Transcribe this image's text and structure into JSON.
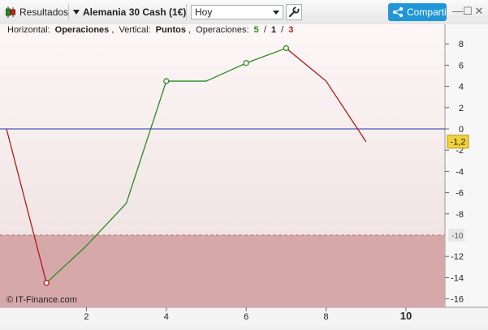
{
  "toolbar": {
    "results_label": "Resultados",
    "instrument": "Alemania 30 Cash (1€)",
    "period_value": "Hoy",
    "share_label": "Compartir"
  },
  "header": {
    "h_label": "Horizontal:",
    "h_value": "Operaciones",
    "sep1": ",",
    "v_label": "Vertical:",
    "v_value": "Puntos",
    "sep2": ",",
    "ops_label": "Operaciones:",
    "ops_win": "5",
    "slash1": "/",
    "ops_even": "1",
    "slash2": "/",
    "ops_loss": "3"
  },
  "watermark": "© IT-Finance.com",
  "colors": {
    "gain": "#2a8a1f",
    "loss": "#b01a1a",
    "zero": "#2233aa",
    "accent": "#2196d6"
  },
  "chart_data": {
    "type": "line",
    "x": [
      0,
      1,
      2,
      3,
      4,
      5,
      6,
      7,
      8,
      9
    ],
    "y": [
      0,
      -14.5,
      -11,
      -7,
      4.5,
      4.5,
      6.2,
      7.6,
      4.5,
      -1.2
    ],
    "marked_points": [
      1,
      4,
      6,
      7
    ],
    "xlim": [
      0,
      11
    ],
    "ylim": [
      -17,
      10
    ],
    "x_ticks": [
      {
        "v": 2,
        "label": "2"
      },
      {
        "v": 4,
        "label": "4"
      },
      {
        "v": 6,
        "label": "6"
      },
      {
        "v": 8,
        "label": "8"
      },
      {
        "v": 10,
        "label": "10"
      }
    ],
    "y_ticks": [
      8,
      6,
      4,
      2,
      0,
      -2,
      -4,
      -6,
      -8,
      -12,
      -14,
      -16
    ],
    "current_value_label": "-1,2",
    "threshold": -10,
    "threshold_label": "-10"
  }
}
